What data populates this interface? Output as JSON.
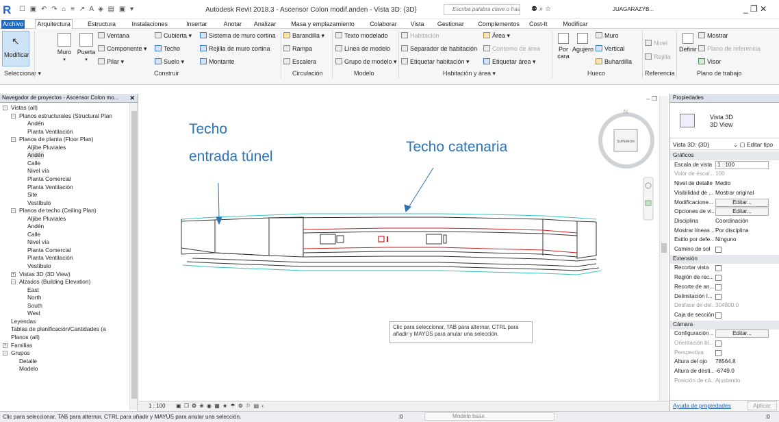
{
  "titlebar": {
    "qat_icons": "☐ ▣ ↶ ↷ ⌂ ≡ ↗ A ◈ ▤ ▣ ▾",
    "title": "Autodesk Revit 2018.3 -    Ascensor Colon modif.anden - Vista 3D: {3D}",
    "search_placeholder": "Escriba palabra clave o frase",
    "user": "JUAGARAZYB...",
    "tools_icons": "⚉ ⌕ ☆",
    "window_controls": "_  ❐  ✕"
  },
  "tabs": [
    "Archivo",
    "Arquitectura",
    "Estructura",
    "Instalaciones",
    "Insertar",
    "Anotar",
    "Analizar",
    "Masa y emplazamiento",
    "Colaborar",
    "Vista",
    "Gestionar",
    "Complementos",
    "Cost-It",
    "Modificar"
  ],
  "ribbon": {
    "select": {
      "modify": "Modificar",
      "label": "Seleccionar ▾"
    },
    "build": {
      "muro": "Muro",
      "puerta": "Puerta",
      "ventana": "Ventana",
      "componente": "Componente ▾",
      "pilar": "Pilar ▾",
      "cubierta": "Cubierta ▾",
      "techo": "Techo",
      "suelo": "Suelo ▾",
      "sistema_muro": "Sistema de muro cortina",
      "rejilla_muro": "Rejilla de muro cortina",
      "montante": "Montante",
      "label": "Construir"
    },
    "circulation": {
      "barandilla": "Barandilla ▾",
      "rampa": "Rampa",
      "escalera": "Escalera",
      "label": "Circulación"
    },
    "model": {
      "texto": "Texto modelado",
      "linea": "Línea de modelo",
      "grupo": "Grupo de modelo ▾",
      "label": "Modelo"
    },
    "room": {
      "habitacion": "Habitación",
      "separador": "Separador de habitación",
      "etiquetar_hab": "Etiquetar  habitación ▾",
      "area": "Área ▾",
      "contorno": "Contorno de área",
      "etiquetar_area": "Etiquetar área ▾",
      "label": "Habitación y área ▾"
    },
    "opening": {
      "por_cara": "Por\ncara",
      "agujero": "Agujero",
      "muro": "Muro",
      "vertical": "Vertical",
      "buhardilla": "Buhardilla",
      "label": "Hueco"
    },
    "datum": {
      "nivel": "Nivel",
      "rejilla": "Rejilla",
      "label": "Referencia"
    },
    "workplane": {
      "definir": "Definir",
      "mostrar": "Mostrar",
      "plano_ref": "Plano de referencia",
      "visor": "Visor",
      "label": "Plano de trabajo"
    }
  },
  "navigator": {
    "title": "Navegador de proyectos - Ascensor Colon mo...",
    "close": "✕",
    "nodes": [
      {
        "label": "Vistas (all)",
        "level": 0,
        "toggle": "−"
      },
      {
        "label": "Planos estructurales (Structural Plan",
        "level": 1,
        "toggle": "−"
      },
      {
        "label": "Andén",
        "level": 2
      },
      {
        "label": "Planta Ventilación",
        "level": 2
      },
      {
        "label": "Planos de planta (Floor Plan)",
        "level": 1,
        "toggle": "−"
      },
      {
        "label": "Aljibe Pluviales",
        "level": 2
      },
      {
        "label": "Andén",
        "level": 2,
        "selected": true
      },
      {
        "label": "Calle",
        "level": 2
      },
      {
        "label": "Nivel vía",
        "level": 2
      },
      {
        "label": "Planta Comercial",
        "level": 2
      },
      {
        "label": "Planta Ventilación",
        "level": 2
      },
      {
        "label": "Site",
        "level": 2
      },
      {
        "label": "Vestíbulo",
        "level": 2
      },
      {
        "label": "Planos de techo (Ceiling Plan)",
        "level": 1,
        "toggle": "−"
      },
      {
        "label": "Aljibe Pluviales",
        "level": 2
      },
      {
        "label": "Andén",
        "level": 2
      },
      {
        "label": "Calle",
        "level": 2
      },
      {
        "label": "Nivel vía",
        "level": 2
      },
      {
        "label": "Planta Comercial",
        "level": 2
      },
      {
        "label": "Planta Ventilación",
        "level": 2
      },
      {
        "label": "Vestíbulo",
        "level": 2
      },
      {
        "label": "Vistas 3D (3D View)",
        "level": 1,
        "toggle": "+"
      },
      {
        "label": "Alzados (Building Elevation)",
        "level": 1,
        "toggle": "−"
      },
      {
        "label": "East",
        "level": 2
      },
      {
        "label": "North",
        "level": 2
      },
      {
        "label": "South",
        "level": 2
      },
      {
        "label": "West",
        "level": 2
      },
      {
        "label": "Leyendas",
        "level": 0
      },
      {
        "label": "Tablas de planificación/Cantidades (a",
        "level": 0
      },
      {
        "label": "Planos (all)",
        "level": 0
      },
      {
        "label": "Familias",
        "level": 0,
        "toggle": "+"
      },
      {
        "label": "Grupos",
        "level": 0,
        "toggle": "−"
      },
      {
        "label": "Detalle",
        "level": 1
      },
      {
        "label": "Modelo",
        "level": 1
      }
    ]
  },
  "canvas": {
    "annotations": {
      "techo_entrada_1": "Techo",
      "techo_entrada_2": "entrada túnel",
      "techo_catenaria": "Techo catenaria"
    },
    "viewcube_label": "SUPERIOR",
    "window_ctrls": "– ❐ ✕",
    "tooltip": "Clic para seleccionar, TAB para alternar, CTRL para añadir y MAYÚS para anular una selección.",
    "view_bar": {
      "scale": "1 : 100",
      "icons": "▣ ❐ ❂ ❀ ◉ ▦ ★ ☂ ⚙ ⚐ ▤ ‹"
    }
  },
  "properties": {
    "title": "Propiedades",
    "type_name_1": "Vista 3D",
    "type_name_2": "3D View",
    "selector": "Vista 3D: {3D}",
    "edit_type": "Editar tipo",
    "rows": [
      {
        "kind": "group",
        "k": "Gráficos"
      },
      {
        "k": "Escala de vista",
        "box": "1 : 100"
      },
      {
        "k": "Valor de escal...",
        "v": "100",
        "dis": true
      },
      {
        "k": "Nivel de detalle",
        "v": "Medio"
      },
      {
        "k": "Visibilidad de ...",
        "v": "Mostrar original"
      },
      {
        "k": "Modificacione...",
        "btn": "Editar..."
      },
      {
        "k": "Opciones de vi...",
        "btn": "Editar..."
      },
      {
        "k": "Disciplina",
        "v": "Coordinación"
      },
      {
        "k": "Mostrar líneas ...",
        "v": "Por disciplina"
      },
      {
        "k": "Estilo por defe...",
        "v": "Ninguno"
      },
      {
        "k": "Camino de sol",
        "cb": true
      },
      {
        "kind": "group",
        "k": "Extensión"
      },
      {
        "k": "Recortar vista",
        "cb": true
      },
      {
        "k": "Región de rec...",
        "cb": true
      },
      {
        "k": "Recorte de an...",
        "cb": true
      },
      {
        "k": "Delimitación l...",
        "cb": true
      },
      {
        "k": "Desfase de del...",
        "v": "304800.0",
        "dis": true
      },
      {
        "k": "Caja de sección",
        "cb": true
      },
      {
        "kind": "group",
        "k": "Cámara"
      },
      {
        "k": "Configuración ...",
        "btn": "Editar..."
      },
      {
        "k": "Orientación bl...",
        "cb": true,
        "dis": true
      },
      {
        "k": "Perspectiva",
        "cb": true,
        "dis": true
      },
      {
        "k": "Altura del ojo",
        "v": "78564.8"
      },
      {
        "k": "Altura de desti...",
        "v": "-6749.0"
      },
      {
        "k": "Posición de cá...",
        "v": "Ajustando",
        "dis": true
      }
    ],
    "help_link": "Ayuda de propiedades",
    "apply": "Aplicar"
  },
  "statusbar": {
    "text": "Clic para seleccionar, TAB para alternar, CTRL para añadir y MAYÚS para anular una selección.",
    "workset_count": ":0",
    "model_label": "Modelo base",
    "right_counter": ":0"
  }
}
